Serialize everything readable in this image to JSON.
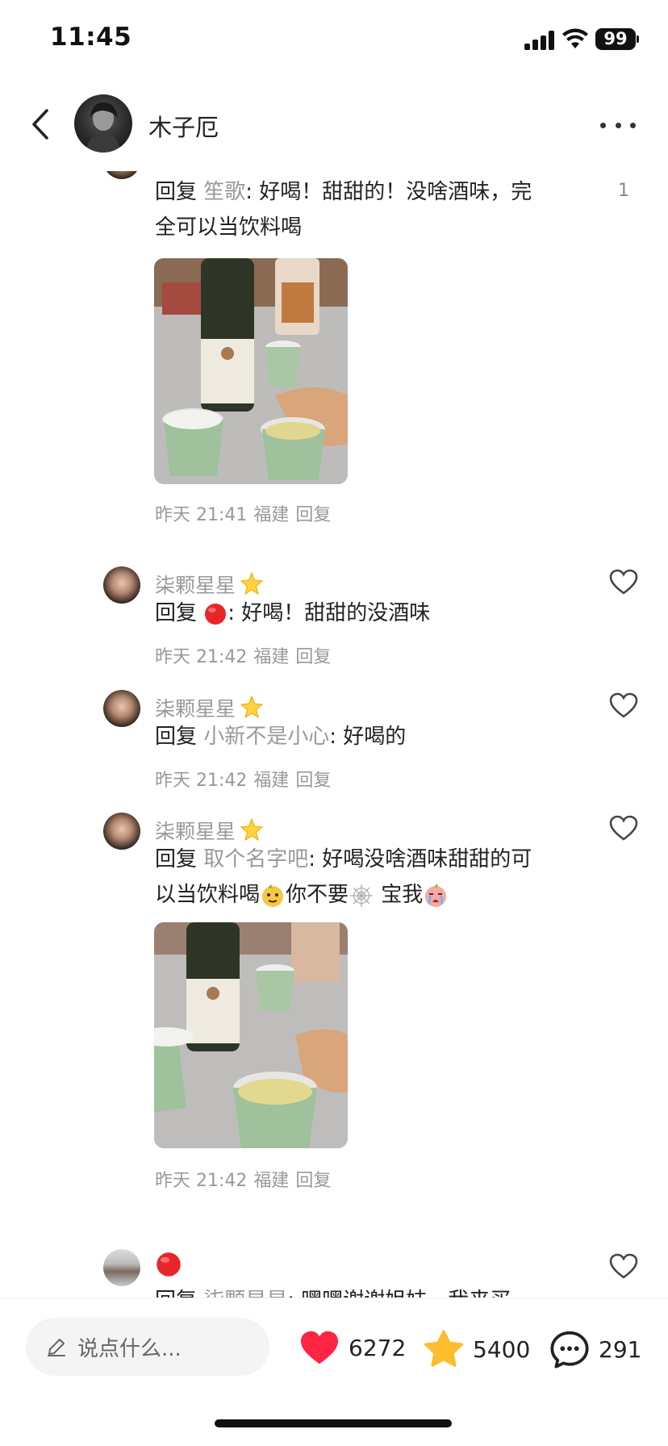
{
  "status_bar": {
    "time": "11:45",
    "battery": "99"
  },
  "header": {
    "username": "木子厄"
  },
  "comments": [
    {
      "prefix": "回复 ",
      "mention": "笙歌",
      "text_line1": ": 好喝！甜甜的！没啥酒味，完",
      "text_line2": "全可以当饮料喝",
      "like_count": "1",
      "time": "昨天 21:41",
      "location": "福建",
      "reply_label": "回复"
    },
    {
      "username": "柒颗星星",
      "prefix": "回复 ",
      "text": ": 好喝！甜甜的没酒味",
      "time": "昨天 21:42",
      "location": "福建",
      "reply_label": "回复"
    },
    {
      "username": "柒颗星星",
      "prefix": "回复 ",
      "mention": "小新不是小心",
      "text": ": 好喝的",
      "time": "昨天 21:42",
      "location": "福建",
      "reply_label": "回复"
    },
    {
      "username": "柒颗星星",
      "prefix": "回复 ",
      "mention": "取个名字吧",
      "text_line1": ": 好喝没啥酒味甜甜的可",
      "text_line2a": "以当饮料喝",
      "text_line2b": "你不要",
      "text_line2c": " 宝我",
      "time": "昨天 21:42",
      "location": "福建",
      "reply_label": "回复"
    },
    {
      "prefix": "回复 ",
      "mention": "柒颗星星",
      "text": ": 嘿嘿谢谢姐妹，我来买"
    }
  ],
  "bottom_bar": {
    "input_placeholder": "说点什么...",
    "likes": "6272",
    "favorites": "5400",
    "comments": "291"
  },
  "colors": {
    "heart": "#ff2442",
    "star": "#fdbd2c",
    "muted": "#999999"
  }
}
